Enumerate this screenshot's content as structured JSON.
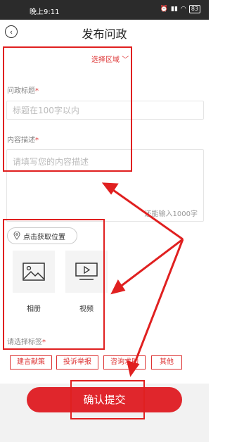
{
  "status_bar": {
    "time": "晚上9:11",
    "battery": "83"
  },
  "header": {
    "title": "发布问政"
  },
  "region": {
    "label": "选择区域"
  },
  "form": {
    "title_label": "问政标题",
    "title_placeholder": "标题在100字以内",
    "desc_label": "内容描述",
    "desc_placeholder": "请填写您的内容描述",
    "desc_counter": "还能输入1000字",
    "required_mark": "*"
  },
  "location": {
    "label": "点击获取位置"
  },
  "media": [
    {
      "label": "相册",
      "icon": "image-icon"
    },
    {
      "label": "视频",
      "icon": "video-icon"
    }
  ],
  "tags": {
    "label": "请选择标签",
    "items": [
      "建言献策",
      "投诉举报",
      "咨询求助",
      "其他"
    ]
  },
  "confirm": {
    "label": "确认提交"
  },
  "colors": {
    "accent": "#e0262c",
    "annotation": "#e02020"
  }
}
